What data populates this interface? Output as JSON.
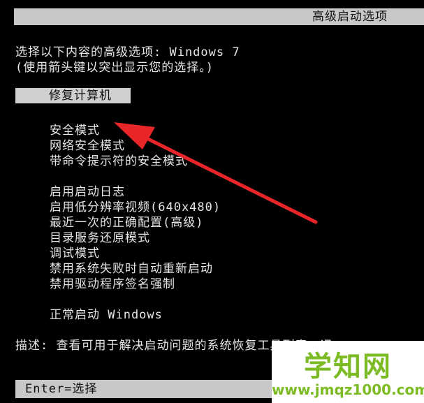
{
  "title": "高级启动选项",
  "prompt": {
    "line1": "选择以下内容的高级选项: Windows 7",
    "line2": "(使用箭头键以突出显示您的选择。)"
  },
  "selected_option": "修复计算机",
  "menu_group1": [
    "安全模式",
    "网络安全模式",
    "带命令提示符的安全模式"
  ],
  "menu_group2": [
    "启用启动日志",
    "启用低分辨率视频(640x480)",
    "最近一次的正确配置(高级)",
    "目录服务还原模式",
    "调试模式",
    "禁用系统失败时自动重新启动",
    "禁用驱动程序签名强制"
  ],
  "menu_group3": [
    "正常启动 Windows"
  ],
  "description": "描述: 查看可用于解决启动问题的系统恢复工具列表。运",
  "footer": "Enter=选择",
  "watermark": {
    "logo": "学知网",
    "url": "www.jmqz1000.com"
  },
  "colors": {
    "background": "#000000",
    "highlight": "#c8c8c8",
    "text": "#e6e6e6",
    "arrow": "#e8262a",
    "watermark": "#7dbb25"
  }
}
